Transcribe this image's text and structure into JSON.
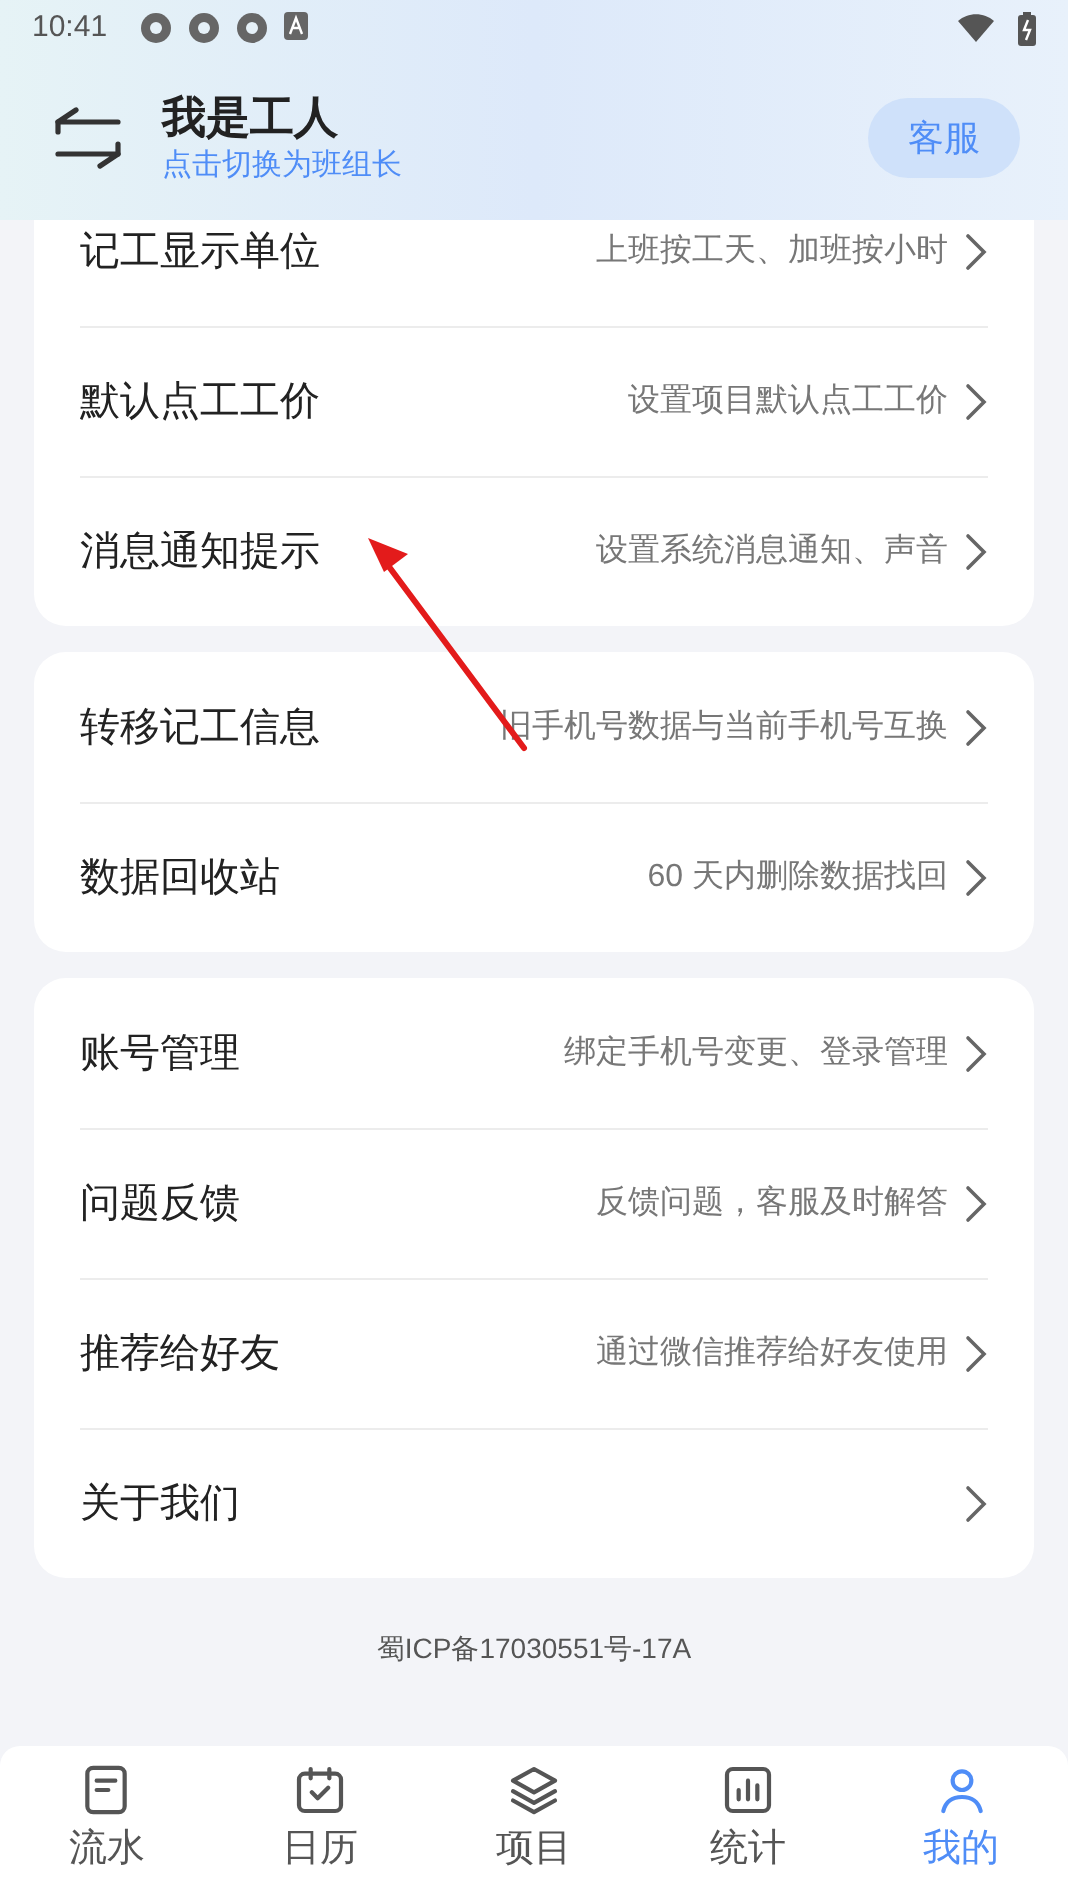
{
  "status_bar": {
    "time": "10:41"
  },
  "header": {
    "title": "我是工人",
    "subtitle": "点击切换为班组长",
    "service_button": "客服"
  },
  "groups": [
    [
      {
        "label": "记工显示单位",
        "hint": "上班按工天、加班按小时"
      },
      {
        "label": "默认点工工价",
        "hint": "设置项目默认点工工价"
      },
      {
        "label": "消息通知提示",
        "hint": "设置系统消息通知、声音"
      }
    ],
    [
      {
        "label": "转移记工信息",
        "hint": "旧手机号数据与当前手机号互换"
      },
      {
        "label": "数据回收站",
        "hint": "60 天内删除数据找回"
      }
    ],
    [
      {
        "label": "账号管理",
        "hint": "绑定手机号变更、登录管理"
      },
      {
        "label": "问题反馈",
        "hint": "反馈问题，客服及时解答"
      },
      {
        "label": "推荐给好友",
        "hint": "通过微信推荐给好友使用"
      },
      {
        "label": "关于我们"
      }
    ]
  ],
  "footer": "蜀ICP备17030551号-17A",
  "tabs": [
    {
      "label": "流水",
      "kind": "note",
      "selected": false
    },
    {
      "label": "日历",
      "kind": "calendar",
      "selected": false
    },
    {
      "label": "项目",
      "kind": "layers",
      "selected": false
    },
    {
      "label": "统计",
      "kind": "chart",
      "selected": false
    },
    {
      "label": "我的",
      "kind": "user",
      "selected": true
    }
  ]
}
